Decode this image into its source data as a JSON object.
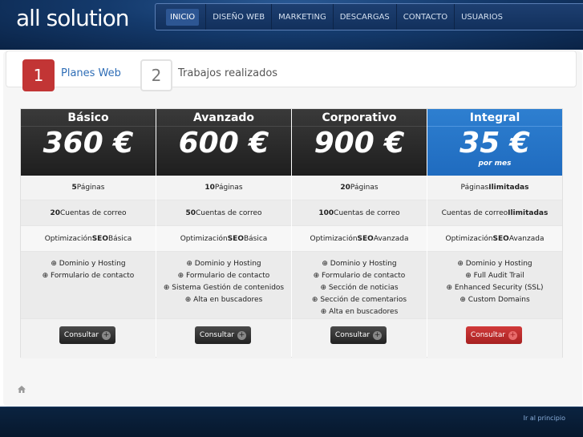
{
  "brand": {
    "logo_text": "all solution"
  },
  "nav": {
    "items": [
      {
        "label": "INICIO",
        "active": true
      },
      {
        "label": "DISEÑO WEB",
        "active": false
      },
      {
        "label": "MARKETING",
        "active": false
      },
      {
        "label": "DESCARGAS",
        "active": false
      },
      {
        "label": "CONTACTO",
        "active": false
      },
      {
        "label": "USUARIOS",
        "active": false
      }
    ]
  },
  "tabs": [
    {
      "number": "1",
      "label": "Planes Web",
      "active": true
    },
    {
      "number": "2",
      "label": "Trabajos realizados",
      "active": false
    }
  ],
  "plans": [
    {
      "name": "Básico",
      "price": "360 €",
      "period": "",
      "pages": {
        "bold": "5",
        "rest": " Páginas"
      },
      "email": {
        "bold": "20",
        "rest": " Cuentas de correo"
      },
      "seo": {
        "pre": "Optimización ",
        "bold": "SEO",
        "post": " Básica"
      },
      "features": [
        "⊕ Dominio y Hosting",
        "⊕ Formulario de contacto"
      ],
      "button_label": "Consultar"
    },
    {
      "name": "Avanzado",
      "price": "600 €",
      "period": "",
      "pages": {
        "bold": "10",
        "rest": " Páginas"
      },
      "email": {
        "bold": "50",
        "rest": " Cuentas de correo"
      },
      "seo": {
        "pre": "Optimización ",
        "bold": "SEO",
        "post": " Básica"
      },
      "features": [
        "⊕ Dominio y Hosting",
        "⊕ Formulario de contacto",
        "⊕ Sistema Gestión de contenidos",
        "⊕ Alta en buscadores"
      ],
      "button_label": "Consultar"
    },
    {
      "name": "Corporativo",
      "price": "900 €",
      "period": "",
      "pages": {
        "bold": "20",
        "rest": " Páginas"
      },
      "email": {
        "bold": "100",
        "rest": " Cuentas de correo"
      },
      "seo": {
        "pre": "Optimización ",
        "bold": "SEO",
        "post": " Avanzada"
      },
      "features": [
        "⊕ Dominio y Hosting",
        "⊕ Formulario de contacto",
        "⊕ Sección de noticias",
        "⊕ Sección de comentarios",
        "⊕ Alta en buscadores"
      ],
      "button_label": "Consultar"
    },
    {
      "name": "Integral",
      "price": "35 €",
      "period": "por mes",
      "pages": {
        "pre": "Páginas ",
        "bold": "Ilimitadas"
      },
      "email": {
        "pre": "Cuentas de correo ",
        "bold": "Ilimitadas"
      },
      "seo": {
        "pre": "Optimización ",
        "bold": "SEO",
        "post": " Avanzada"
      },
      "features": [
        "⊕ Dominio y Hosting",
        "⊕ Full Audit Trail",
        "⊕ Enhanced Security (SSL)",
        "⊕ Custom Domains"
      ],
      "button_label": "Consultar"
    }
  ],
  "colors": {
    "accent_red": "#c23535",
    "accent_blue": "#1f6bbf",
    "dark_header": "#1e1e1e"
  },
  "footer": {
    "top_link": "Ir al principio"
  },
  "icons": {
    "home": "home-icon",
    "plus": "plus-circle-icon"
  }
}
